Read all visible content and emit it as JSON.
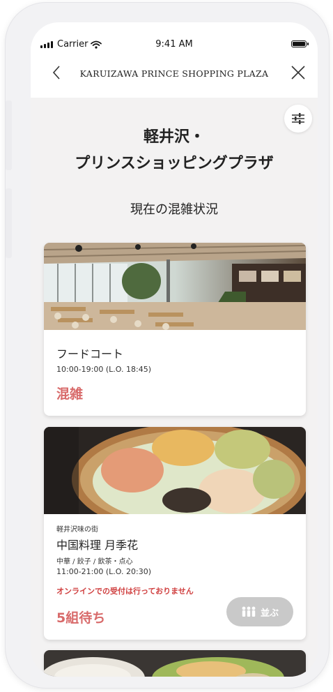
{
  "status_bar": {
    "carrier": "Carrier",
    "time": "9:41 AM"
  },
  "nav": {
    "title": "KARUIZAWA PRINCE SHOPPING PLAZA"
  },
  "header": {
    "title": "軽井沢・\nプリンスショッピングプラザ",
    "subtitle": "現在の混雑状況"
  },
  "cards": [
    {
      "image": "food-court-photo",
      "name": "フードコート",
      "hours": "10:00-19:00 (L.O. 18:45)",
      "status": "混雑"
    },
    {
      "image": "xiaolongbao-photo",
      "area": "軽井沢味の街",
      "name": "中国料理 月季花",
      "category": "中華 / 餃子 / 飲茶・点心",
      "hours": "11:00-21:00 (L.O. 20:30)",
      "note": "オンラインでの受付は行っておりません",
      "wait": "5組待ち",
      "queue_label": "並ぶ"
    },
    {
      "image": "salad-dish-photo"
    }
  ],
  "colors": {
    "accent_red": "#d86a6a",
    "note_red": "#d04040",
    "button_gray": "#c9c9c9"
  }
}
